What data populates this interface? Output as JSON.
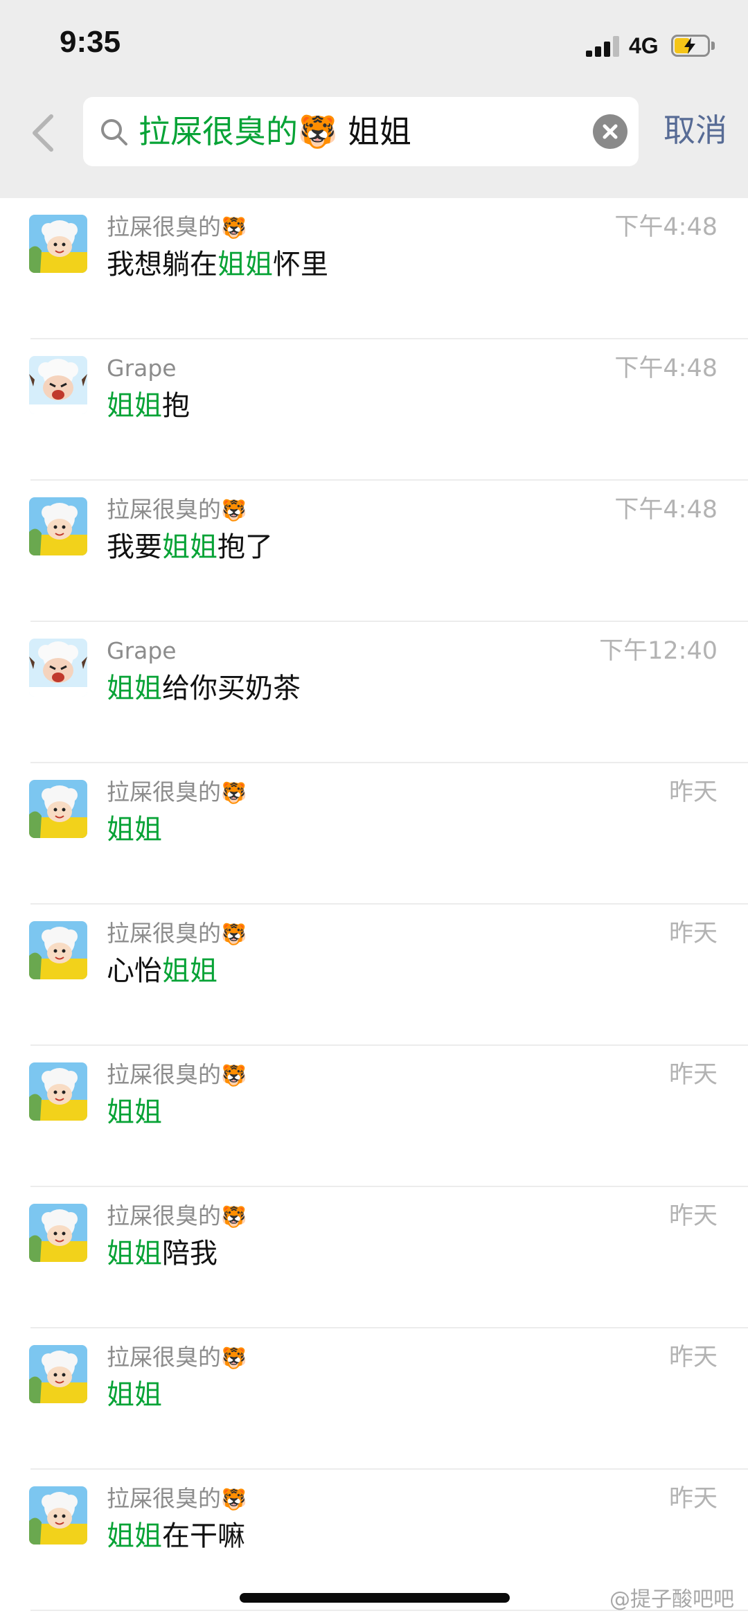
{
  "status_bar": {
    "time": "9:35",
    "network": "4G",
    "signal_icon": "cellular-signal-icon",
    "battery_icon": "battery-charging-icon",
    "battery_color": "#f5c518"
  },
  "header": {
    "back_icon": "chevron-left-icon",
    "search_icon": "magnifier-icon",
    "search": {
      "contact_name": "拉屎很臭的",
      "contact_emoji": "🐯",
      "term": "姐姐"
    },
    "clear_icon": "clear-circle-icon",
    "cancel_label": "取消"
  },
  "colors": {
    "highlight": "#07a336",
    "link": "#576b95",
    "header_bg": "#ededed"
  },
  "results": [
    {
      "avatar": "lamb-avatar-a",
      "sender": "拉屎很臭的",
      "emoji": "🐯",
      "before": "我想躺在",
      "keyword": "姐姐",
      "after": "怀里",
      "time": "下午4:48"
    },
    {
      "avatar": "lamb-avatar-b",
      "sender": "Grape",
      "emoji": "",
      "before": "",
      "keyword": "姐姐",
      "after": "抱",
      "time": "下午4:48"
    },
    {
      "avatar": "lamb-avatar-a",
      "sender": "拉屎很臭的",
      "emoji": "🐯",
      "before": "我要",
      "keyword": "姐姐",
      "after": "抱了",
      "time": "下午4:48"
    },
    {
      "avatar": "lamb-avatar-b",
      "sender": "Grape",
      "emoji": "",
      "before": "",
      "keyword": "姐姐",
      "after": "给你买奶茶",
      "time": "下午12:40"
    },
    {
      "avatar": "lamb-avatar-a",
      "sender": "拉屎很臭的",
      "emoji": "🐯",
      "before": "",
      "keyword": "姐姐",
      "after": "",
      "time": "昨天"
    },
    {
      "avatar": "lamb-avatar-a",
      "sender": "拉屎很臭的",
      "emoji": "🐯",
      "before": "心怡",
      "keyword": "姐姐",
      "after": "",
      "time": "昨天"
    },
    {
      "avatar": "lamb-avatar-a",
      "sender": "拉屎很臭的",
      "emoji": "🐯",
      "before": "",
      "keyword": "姐姐",
      "after": "",
      "time": "昨天"
    },
    {
      "avatar": "lamb-avatar-a",
      "sender": "拉屎很臭的",
      "emoji": "🐯",
      "before": "",
      "keyword": "姐姐",
      "after": "陪我",
      "time": "昨天"
    },
    {
      "avatar": "lamb-avatar-a",
      "sender": "拉屎很臭的",
      "emoji": "🐯",
      "before": "",
      "keyword": "姐姐",
      "after": "",
      "time": "昨天"
    },
    {
      "avatar": "lamb-avatar-a",
      "sender": "拉屎很臭的",
      "emoji": "🐯",
      "before": "",
      "keyword": "姐姐",
      "after": "在干嘛",
      "time": "昨天"
    }
  ],
  "watermark": "@提子酸吧吧"
}
